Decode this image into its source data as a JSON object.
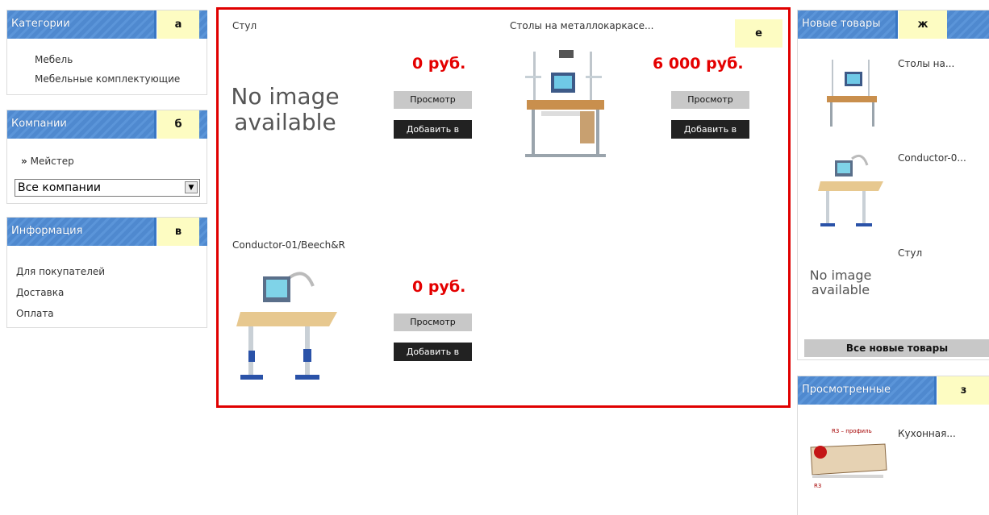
{
  "categories": {
    "title": "Категории",
    "marker": "а",
    "items": [
      "Мебель",
      "Мебельные комплектующие"
    ]
  },
  "companies": {
    "title": "Компании",
    "marker": "б",
    "link": "Мейстер",
    "select_value": "Все компании"
  },
  "info": {
    "title": "Информация",
    "marker": "в",
    "items": [
      "Для покупателей",
      "Доставка",
      "Оплата"
    ]
  },
  "catalog": {
    "marker": "е",
    "no_image_text": "No image available",
    "view_label": "Просмотр",
    "add_label": "Добавить в",
    "products": [
      {
        "name": "Стул",
        "price": "0 руб."
      },
      {
        "name": "Столы на металлокаркасе...",
        "price": "6 000 руб."
      },
      {
        "name": "Conductor-01/Beech&R",
        "price": "0 руб."
      }
    ]
  },
  "new_items": {
    "title": "Новые товары",
    "marker": "ж",
    "items": [
      "Столы на...",
      "Conductor-0...",
      "Стул"
    ],
    "no_image_text": "No image available",
    "all_button": "Все новые товары"
  },
  "viewed": {
    "title": "Просмотренные",
    "marker": "з",
    "items": [
      "Кухонная..."
    ],
    "img_label_top": "R3 – профиль",
    "img_label_bottom": "R3"
  },
  "colors": {
    "header_blue": "#4f89cf",
    "marker_yellow": "#fdfcc2",
    "price_red": "#e40000",
    "frame_red": "#e00000"
  }
}
